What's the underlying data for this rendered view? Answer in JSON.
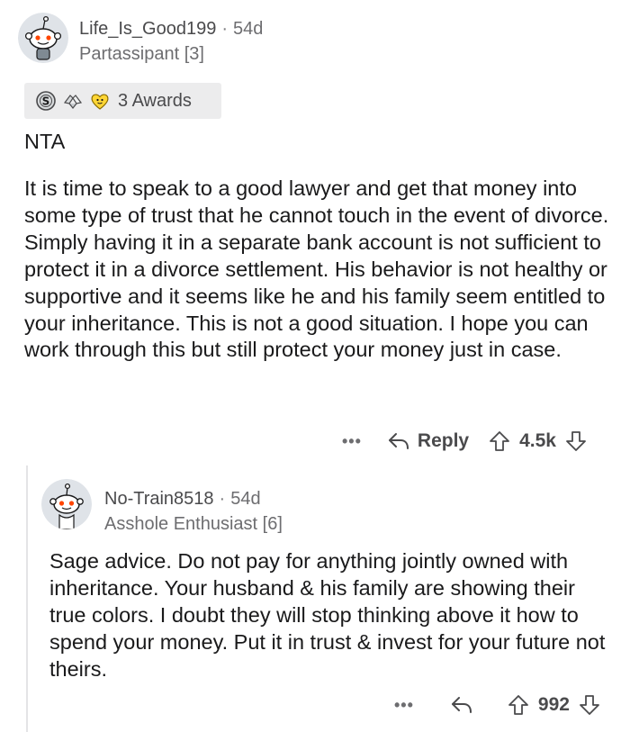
{
  "comment": {
    "username": "Life_Is_Good199",
    "separator": "·",
    "age": "54d",
    "flair": "Partassipant [3]",
    "awards_label": "3 Awards",
    "verdict": "NTA",
    "body": "It is time to speak to a good lawyer and get that money into some type of trust that he cannot touch in the event of divorce. Simply having it in a separate bank account is not sufficient to protect it in a divorce settlement. His behavior is not healthy or supportive and it seems like he and his family seem entitled to your inheritance. This is not a good situation. I hope you can work through this but still protect your money just in case.",
    "actions": {
      "more": "•••",
      "reply_label": "Reply",
      "score": "4.5k"
    }
  },
  "reply": {
    "username": "No-Train8518",
    "separator": "·",
    "age": "54d",
    "flair": "Asshole Enthusiast [6]",
    "body": "Sage advice.  Do not pay for anything jointly owned with inheritance. Your husband & his family are showing their true colors.  I doubt they will stop thinking above it how to spend your money.  Put it in trust & invest for your future not theirs.",
    "actions": {
      "more": "•••",
      "score": "992"
    }
  },
  "icons": {
    "award_1": "silver-coin-icon",
    "award_2": "helpful-hands-icon",
    "award_3": "wholesome-heart-icon",
    "reply": "reply-arrow-icon",
    "upvote": "upvote-arrow-icon",
    "downvote": "downvote-arrow-icon"
  },
  "colors": {
    "text": "#1a1a1b",
    "meta": "#4a4a4c",
    "award_bg": "#ececed",
    "thread_line": "#e4e4e6",
    "avatar_bg": "#dfe3e8"
  }
}
